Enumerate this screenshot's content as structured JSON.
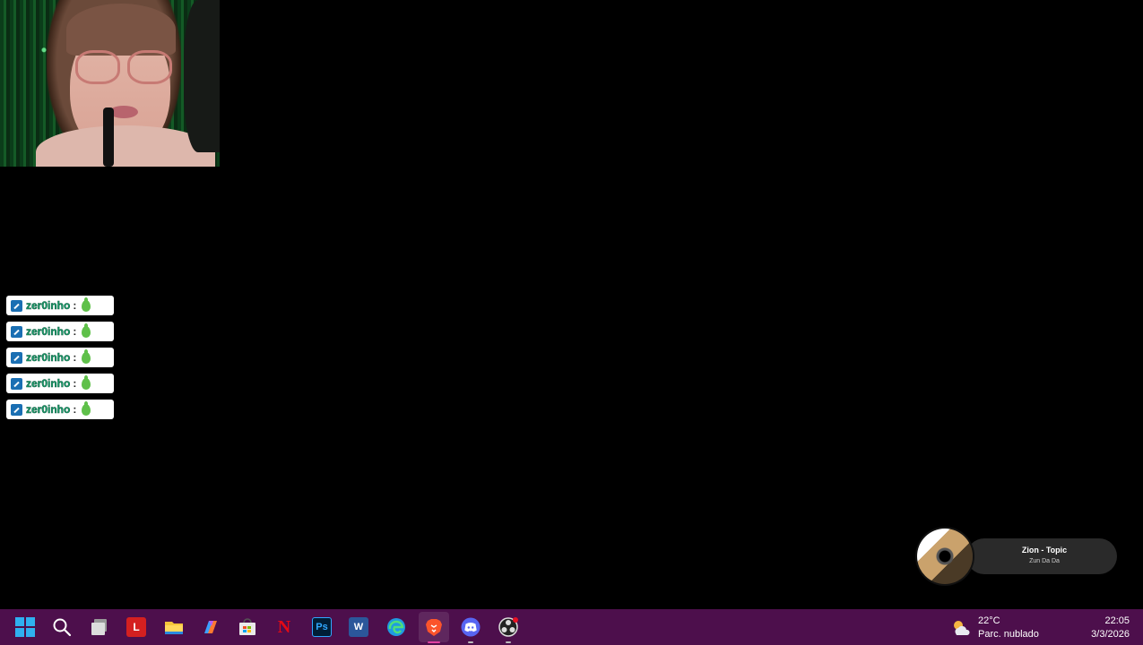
{
  "chat": {
    "messages": [
      {
        "username": "zer0inho",
        "separator": ":"
      },
      {
        "username": "zer0inho",
        "separator": ":"
      },
      {
        "username": "zer0inho",
        "separator": ":"
      },
      {
        "username": "zer0inho",
        "separator": ":"
      },
      {
        "username": "zer0inho",
        "separator": ":"
      }
    ]
  },
  "media": {
    "title": "Zion - Topic",
    "track": "Zun Da Da"
  },
  "taskbar": {
    "apps": [
      "start-icon",
      "search-icon",
      "task-view-icon",
      "l-app-icon",
      "file-explorer-icon",
      "copilot-icon",
      "microsoft-store-icon",
      "netflix-icon",
      "photoshop-icon",
      "word-icon",
      "edge-icon",
      "brave-icon",
      "discord-icon",
      "obs-icon"
    ],
    "photoshop_label": "Ps",
    "word_label": "W",
    "l_label": "L",
    "netflix_label": "N"
  },
  "weather": {
    "temp": "22°C",
    "condition": "Parc. nublado"
  },
  "clock": {
    "time": "22:05",
    "date": "3/3/2026"
  },
  "colors": {
    "taskbar_bg": "#4d0f4c",
    "chat_username": "#19a06d",
    "active_indicator": "#e040a0"
  }
}
